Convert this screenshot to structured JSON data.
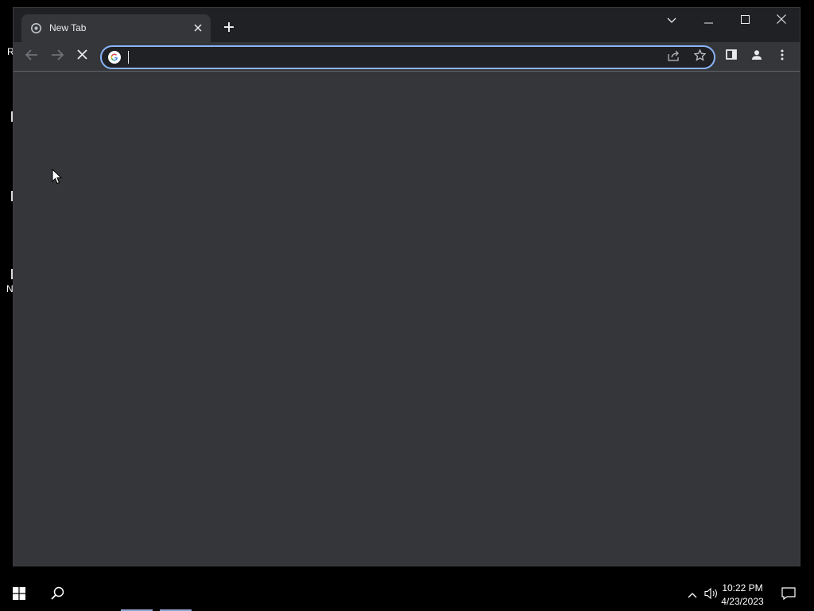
{
  "browser": {
    "tab": {
      "title": "New Tab"
    },
    "address_bar": {
      "value": "",
      "placeholder": ""
    },
    "colors": {
      "frame": "#202124",
      "toolbar": "#35363a",
      "omnibox_focus": "#8ab4f8",
      "text": "#e8eaed"
    }
  },
  "desktop": {
    "fragments": [
      "R",
      "N"
    ]
  },
  "taskbar": {
    "clock_time": "10:22 PM",
    "clock_date": "4/23/2023"
  },
  "icons": {
    "tab_favicon": "chrome-icon",
    "tab_close": "close-icon",
    "new_tab": "plus-icon",
    "tab_search": "chevron-down-icon",
    "minimize": "minimize-icon",
    "maximize": "maximize-icon",
    "close_window": "close-icon",
    "back": "arrow-left-icon",
    "forward": "arrow-right-icon",
    "stop": "stop-icon",
    "google": "google-icon",
    "share": "share-icon",
    "bookmark": "star-icon",
    "side_panel": "side-panel-icon",
    "profile": "profile-icon",
    "menu": "more-vert-icon"
  }
}
